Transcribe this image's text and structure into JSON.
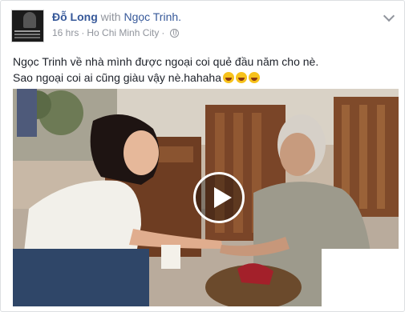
{
  "post": {
    "author": "Đỗ Long",
    "with_word": "with",
    "tagged": "Ngọc Trinh.",
    "time": "16 hrs",
    "separator": "·",
    "location": "Ho Chi Minh City",
    "privacy_icon": "globe-icon",
    "menu_icon": "chevron-down-icon",
    "text_line1": "Ngọc Trinh về nhà mình được ngoại coi quẻ đầu năm cho nè.",
    "text_line2": "Sao ngoại coi ai cũng giàu vậy nè.hahaha",
    "emoji_icon": "grinning-squinting-face-icon",
    "video_play_icon": "play-icon"
  },
  "colors": {
    "link": "#365899",
    "meta": "#90949c",
    "text": "#1d2129",
    "border": "#dddfe2"
  }
}
